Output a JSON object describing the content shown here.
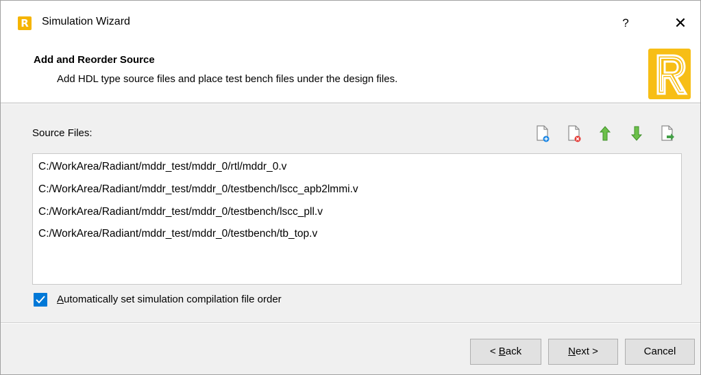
{
  "window": {
    "title": "Simulation Wizard",
    "app_icon_letter": "R",
    "help_label": "?",
    "close_label": "✕"
  },
  "header": {
    "title": "Add and Reorder Source",
    "description": "Add HDL type source files and place test bench files under the design files.",
    "logo": "radiant-logo"
  },
  "source": {
    "label": "Source Files:",
    "toolbar": [
      {
        "name": "add-file-icon",
        "color": "#1e88e5"
      },
      {
        "name": "remove-file-icon",
        "color": "#e53935"
      },
      {
        "name": "move-up-icon",
        "color": "#5cb85c"
      },
      {
        "name": "move-down-icon",
        "color": "#5cb85c"
      },
      {
        "name": "import-file-icon",
        "color": "#43a047"
      }
    ],
    "files": [
      "C:/WorkArea/Radiant/mddr_test/mddr_0/rtl/mddr_0.v",
      "C:/WorkArea/Radiant/mddr_test/mddr_0/testbench/lscc_apb2lmmi.v",
      "C:/WorkArea/Radiant/mddr_test/mddr_0/testbench/lscc_pll.v",
      "C:/WorkArea/Radiant/mddr_test/mddr_0/testbench/tb_top.v"
    ]
  },
  "auto_order": {
    "checked": true,
    "label_mnemonic": "A",
    "label_rest": "utomatically set simulation compilation file order"
  },
  "buttons": {
    "back_mnemonic": "B",
    "back_prefix": "< ",
    "back_rest": "ack",
    "next_mnemonic": "N",
    "next_rest": "ext >",
    "cancel": "Cancel"
  },
  "colors": {
    "accent": "#0078d7",
    "logo_yellow": "#f7be16"
  }
}
